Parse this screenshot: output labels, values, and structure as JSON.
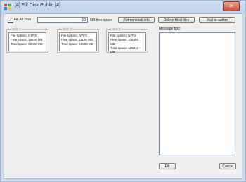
{
  "window": {
    "title": "[#] Fill Disk Public [#]",
    "close_glyph": "✕"
  },
  "fill_all_disk": {
    "label": "Fill All Disk",
    "checked": true,
    "check_glyph": "✓"
  },
  "free_space_input": {
    "value": "10",
    "unit_label": "MB free space"
  },
  "buttons": {
    "refresh": "Refresh disk info",
    "delete": "Delete filled files",
    "mail": "Mail to author",
    "fill": "Fill",
    "cancel": "Cancel"
  },
  "disks": [
    {
      "title": "Disk C",
      "fs": "File system: NTFS",
      "free": "Free space:  19829 MB",
      "total": "Total space: 50000 MB"
    },
    {
      "title": "Disk D",
      "fs": "File system: NTFS",
      "free": "Free space:  11135 MB",
      "total": "Total space: 19898 MB"
    },
    {
      "title": "Disk E",
      "fs": "File system: NTFS",
      "free": "Free space:  106394 MB",
      "total": "Total space: 125242 MB"
    }
  ],
  "message_box": {
    "label": "Message box:"
  }
}
